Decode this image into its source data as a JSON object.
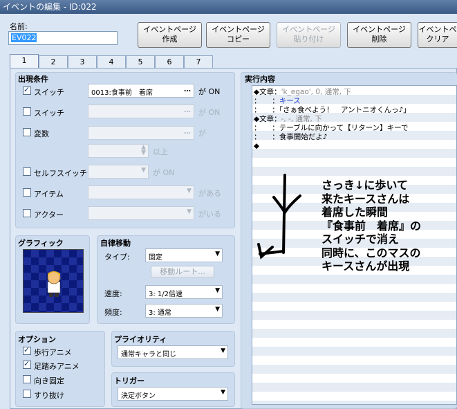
{
  "window": {
    "title": "イベントの編集 - ID:022"
  },
  "name_label": "名前:",
  "name_value": "EV022",
  "toolbar": [
    {
      "line1": "イベントページ",
      "line2": "作成",
      "enabled": true
    },
    {
      "line1": "イベントページ",
      "line2": "コピー",
      "enabled": true
    },
    {
      "line1": "イベントページ",
      "line2": "貼り付け",
      "enabled": false
    },
    {
      "line1": "イベントページ",
      "line2": "削除",
      "enabled": true
    },
    {
      "line1": "イベントペ",
      "line2": "クリア",
      "enabled": true
    }
  ],
  "tabs": [
    "1",
    "2",
    "3",
    "4",
    "5",
    "6",
    "7"
  ],
  "conditions": {
    "title": "出現条件",
    "switch1": {
      "label": "スイッチ",
      "value": "0013:食事前　着席",
      "suffix": "が ON",
      "checked": true
    },
    "switch2": {
      "label": "スイッチ",
      "suffix": "が ON"
    },
    "variable": {
      "label": "変数",
      "suffix": "が"
    },
    "above": "以上",
    "self_switch": {
      "label": "セルフスイッチ",
      "suffix": "が ON"
    },
    "item": {
      "label": "アイテム",
      "suffix": "がある"
    },
    "actor": {
      "label": "アクター",
      "suffix": "がいる"
    }
  },
  "graphic": {
    "title": "グラフィック"
  },
  "movement": {
    "title": "自律移動",
    "type_label": "タイプ:",
    "type_value": "固定",
    "route_button": "移動ルート...",
    "speed_label": "速度:",
    "speed_value": "3: 1/2倍速",
    "freq_label": "頻度:",
    "freq_value": "3: 通常"
  },
  "options": {
    "title": "オプション",
    "items": [
      {
        "label": "歩行アニメ",
        "checked": true
      },
      {
        "label": "足踏みアニメ",
        "checked": true
      },
      {
        "label": "向き固定",
        "checked": false
      },
      {
        "label": "すり抜け",
        "checked": false
      }
    ]
  },
  "priority": {
    "title": "プライオリティ",
    "value": "通常キャラと同じ"
  },
  "trigger": {
    "title": "トリガー",
    "value": "決定ボタン"
  },
  "contents": {
    "title": "実行内容",
    "rows": [
      {
        "prefix": "◆文章：",
        "text": "'k_egao', 0, 通常, 下",
        "style": "gray"
      },
      {
        "prefix": "：　　：",
        "text": "キース",
        "style": "blue"
      },
      {
        "prefix": "：　　：",
        "text": "「さぁ食べよう！　アントニオくんっ♪」",
        "style": "normal"
      },
      {
        "prefix": "◆文章：",
        "text": "-, -, 通常, 下",
        "style": "gray"
      },
      {
        "prefix": "：　　：",
        "text": "テーブルに向かって【リターン】キーで",
        "style": "normal"
      },
      {
        "prefix": "：　　：",
        "text": "食事開始だよ♪",
        "style": "normal"
      },
      {
        "prefix": "◆",
        "text": "",
        "style": "normal"
      }
    ]
  },
  "annotation": {
    "lines": [
      "さっき↓に歩いて",
      "来たキースさんは",
      "着席した瞬間",
      "『食事前　着席』の",
      "スイッチで消え",
      "同時に、このマスの",
      "キースさんが出現"
    ]
  }
}
